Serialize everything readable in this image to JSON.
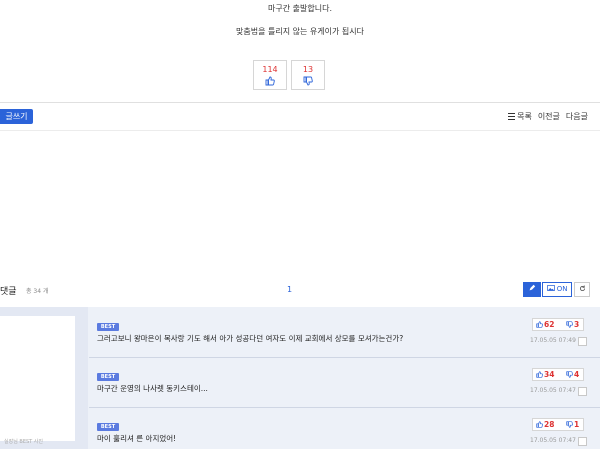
{
  "article": {
    "line1": "마구간 출발합니다.",
    "line2": "맞춤법을 틀리지 않는 유게이가 됩시다"
  },
  "votes": {
    "up": "114",
    "down": "13"
  },
  "nav": {
    "write": "글쓰기",
    "list": "목록",
    "prev": "이전글",
    "next": "다음글"
  },
  "comments_header": {
    "title": "댓글",
    "count": "총 34 개",
    "page": "1",
    "image_toggle": "ON"
  },
  "left_panel": {
    "caption": "실장님 BEST 사진"
  },
  "comments": [
    {
      "badge": "BEST",
      "text": "그러고보니 왕마은이 목사랑 기도 해서 아가 성공다던 여자도 이제 교회에서 상모를 모셔가는건가?",
      "up": "62",
      "down": "3",
      "time": "17.05.05 07:49"
    },
    {
      "badge": "BEST",
      "text": "마구간 운영의 나사렛 동키스테이...",
      "up": "34",
      "down": "4",
      "time": "17.05.05 07:47"
    },
    {
      "badge": "BEST",
      "text": "마이 훌리셔 른 아지었어!",
      "up": "28",
      "down": "1",
      "time": "17.05.05 07:47"
    }
  ],
  "colors": {
    "accent": "#2b63d9",
    "vote_red": "#d33",
    "best_badge": "#5b7be0",
    "comment_bg": "#edf1f8"
  },
  "icons": [
    "thumbs-up-icon",
    "thumbs-down-icon",
    "list-icon",
    "pencil-icon",
    "image-icon",
    "refresh-icon",
    "report-icon"
  ]
}
